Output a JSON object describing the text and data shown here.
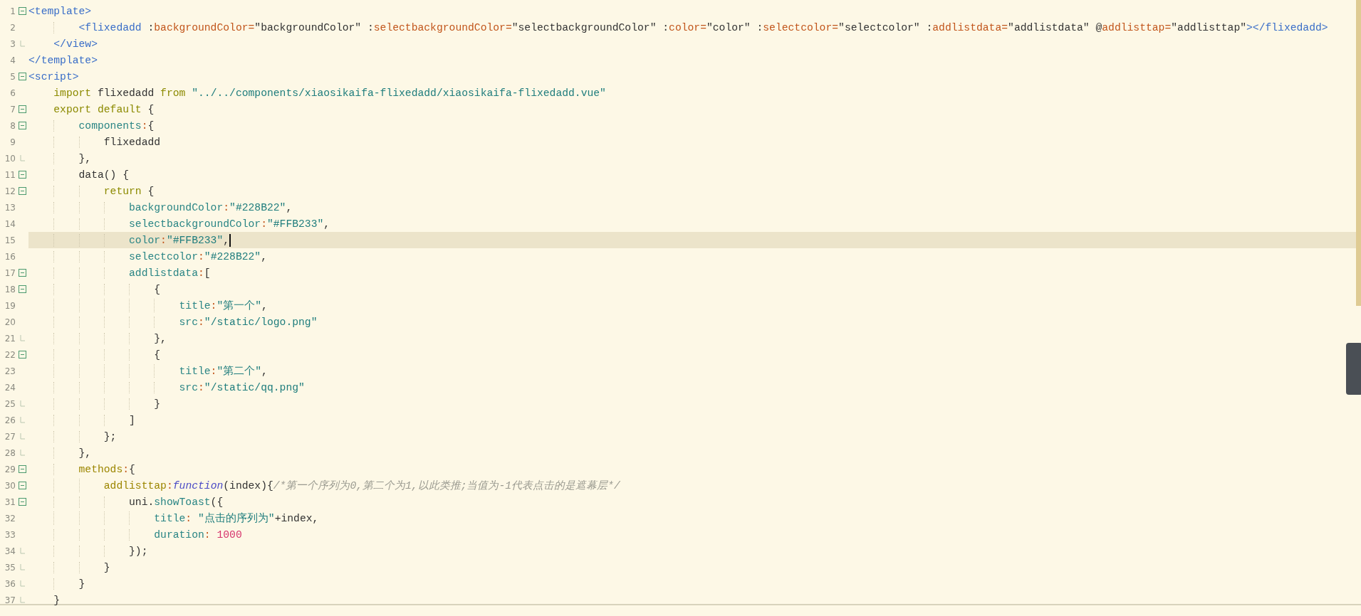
{
  "editor": {
    "lines": [
      {
        "n": "1",
        "kind": "fold-start",
        "selected": false,
        "code": [
          {
            "kind": "tag",
            "t": "<template>"
          }
        ]
      },
      {
        "n": "2",
        "kind": "plain",
        "selected": false,
        "code": [
          {
            "kind": "tag",
            "t": "        <flixedadd"
          },
          {
            "kind": "plain",
            "t": " :"
          },
          {
            "kind": "attr",
            "t": "backgroundColor="
          },
          {
            "kind": "plain",
            "t": "\"backgroundColor\" :"
          },
          {
            "kind": "attr",
            "t": "selectbackgroundColor="
          },
          {
            "kind": "plain",
            "t": "\"selectbackgroundColor\" :"
          },
          {
            "kind": "attr",
            "t": "color="
          },
          {
            "kind": "plain",
            "t": "\"color\" :"
          },
          {
            "kind": "attr",
            "t": "selectcolor="
          },
          {
            "kind": "plain",
            "t": "\"selectcolor\" :"
          },
          {
            "kind": "attr",
            "t": "addlistdata="
          },
          {
            "kind": "plain",
            "t": "\"addlistdata\" @"
          },
          {
            "kind": "attr",
            "t": "addlisttap="
          },
          {
            "kind": "plain",
            "t": "\"addlisttap\""
          },
          {
            "kind": "tag",
            "t": "></flixedadd>"
          }
        ]
      },
      {
        "n": "3",
        "kind": "fold-end",
        "selected": false,
        "code": [
          {
            "kind": "tag",
            "t": "    </view>"
          }
        ]
      },
      {
        "n": "4",
        "kind": "plain",
        "selected": false,
        "code": [
          {
            "kind": "tag",
            "t": "</template>"
          }
        ]
      },
      {
        "n": "5",
        "kind": "fold-start",
        "selected": false,
        "code": [
          {
            "kind": "tag",
            "t": "<script>"
          }
        ]
      },
      {
        "n": "6",
        "kind": "plain",
        "selected": false,
        "code": [
          {
            "kind": "keyword",
            "t": "    import"
          },
          {
            "kind": "plain",
            "t": " flixedadd "
          },
          {
            "kind": "keyword",
            "t": "from"
          },
          {
            "kind": "string",
            "t": " \"../../components/xiaosikaifa-flixedadd/xiaosikaifa-flixedadd.vue\""
          }
        ]
      },
      {
        "n": "7",
        "kind": "fold-start",
        "selected": false,
        "code": [
          {
            "kind": "keyword",
            "t": "    export default"
          },
          {
            "kind": "plain",
            "t": " {"
          }
        ]
      },
      {
        "n": "8",
        "kind": "fold-start",
        "selected": false,
        "code": [
          {
            "kind": "property",
            "t": "        components"
          },
          {
            "kind": "punct",
            "t": ":"
          },
          {
            "kind": "plain",
            "t": "{"
          }
        ]
      },
      {
        "n": "9",
        "kind": "plain",
        "selected": false,
        "code": [
          {
            "kind": "plain",
            "t": "            flixedadd"
          }
        ]
      },
      {
        "n": "10",
        "kind": "fold-end",
        "selected": false,
        "code": [
          {
            "kind": "plain",
            "t": "        },"
          }
        ]
      },
      {
        "n": "11",
        "kind": "fold-start",
        "selected": false,
        "code": [
          {
            "kind": "plain",
            "t": "        data() {"
          }
        ]
      },
      {
        "n": "12",
        "kind": "fold-start",
        "selected": false,
        "code": [
          {
            "kind": "keyword",
            "t": "            return"
          },
          {
            "kind": "plain",
            "t": " {"
          }
        ]
      },
      {
        "n": "13",
        "kind": "plain",
        "selected": false,
        "code": [
          {
            "kind": "property",
            "t": "                backgroundColor"
          },
          {
            "kind": "punct",
            "t": ":"
          },
          {
            "kind": "string",
            "t": "\"#228B22\""
          },
          {
            "kind": "plain",
            "t": ","
          }
        ]
      },
      {
        "n": "14",
        "kind": "plain",
        "selected": false,
        "code": [
          {
            "kind": "property",
            "t": "                selectbackgroundColor"
          },
          {
            "kind": "punct",
            "t": ":"
          },
          {
            "kind": "string",
            "t": "\"#FFB233\""
          },
          {
            "kind": "plain",
            "t": ","
          }
        ]
      },
      {
        "n": "15",
        "kind": "plain",
        "selected": true,
        "code": [
          {
            "kind": "property",
            "t": "                color"
          },
          {
            "kind": "punct",
            "t": ":"
          },
          {
            "kind": "string",
            "t": "\"#FFB233\""
          },
          {
            "kind": "plain",
            "t": ","
          }
        ]
      },
      {
        "n": "16",
        "kind": "plain",
        "selected": false,
        "code": [
          {
            "kind": "property",
            "t": "                selectcolor"
          },
          {
            "kind": "punct",
            "t": ":"
          },
          {
            "kind": "string",
            "t": "\"#228B22\""
          },
          {
            "kind": "plain",
            "t": ","
          }
        ]
      },
      {
        "n": "17",
        "kind": "fold-start",
        "selected": false,
        "code": [
          {
            "kind": "property",
            "t": "                addlistdata"
          },
          {
            "kind": "punct",
            "t": ":"
          },
          {
            "kind": "plain",
            "t": "["
          }
        ]
      },
      {
        "n": "18",
        "kind": "fold-start",
        "selected": false,
        "code": [
          {
            "kind": "plain",
            "t": "                    {"
          }
        ]
      },
      {
        "n": "19",
        "kind": "plain",
        "selected": false,
        "code": [
          {
            "kind": "property",
            "t": "                        title"
          },
          {
            "kind": "punct",
            "t": ":"
          },
          {
            "kind": "string",
            "t": "\"第一个\""
          },
          {
            "kind": "plain",
            "t": ","
          }
        ]
      },
      {
        "n": "20",
        "kind": "plain",
        "selected": false,
        "code": [
          {
            "kind": "property",
            "t": "                        src"
          },
          {
            "kind": "punct",
            "t": ":"
          },
          {
            "kind": "string",
            "t": "\"/static/logo.png\""
          }
        ]
      },
      {
        "n": "21",
        "kind": "fold-end",
        "selected": false,
        "code": [
          {
            "kind": "plain",
            "t": "                    },"
          }
        ]
      },
      {
        "n": "22",
        "kind": "fold-start",
        "selected": false,
        "code": [
          {
            "kind": "plain",
            "t": "                    {"
          }
        ]
      },
      {
        "n": "23",
        "kind": "plain",
        "selected": false,
        "code": [
          {
            "kind": "property",
            "t": "                        title"
          },
          {
            "kind": "punct",
            "t": ":"
          },
          {
            "kind": "string",
            "t": "\"第二个\""
          },
          {
            "kind": "plain",
            "t": ","
          }
        ]
      },
      {
        "n": "24",
        "kind": "plain",
        "selected": false,
        "code": [
          {
            "kind": "property",
            "t": "                        src"
          },
          {
            "kind": "punct",
            "t": ":"
          },
          {
            "kind": "string",
            "t": "\"/static/qq.png\""
          }
        ]
      },
      {
        "n": "25",
        "kind": "fold-end",
        "selected": false,
        "code": [
          {
            "kind": "plain",
            "t": "                    }"
          }
        ]
      },
      {
        "n": "26",
        "kind": "fold-end",
        "selected": false,
        "code": [
          {
            "kind": "plain",
            "t": "                ]"
          }
        ]
      },
      {
        "n": "27",
        "kind": "fold-end",
        "selected": false,
        "code": [
          {
            "kind": "plain",
            "t": "            };"
          }
        ]
      },
      {
        "n": "28",
        "kind": "fold-end",
        "selected": false,
        "code": [
          {
            "kind": "plain",
            "t": "        },"
          }
        ]
      },
      {
        "n": "29",
        "kind": "fold-start",
        "selected": false,
        "code": [
          {
            "kind": "method",
            "t": "        methods"
          },
          {
            "kind": "punct",
            "t": ":"
          },
          {
            "kind": "plain",
            "t": "{"
          }
        ]
      },
      {
        "n": "30",
        "kind": "fold-start",
        "selected": false,
        "code": [
          {
            "kind": "method",
            "t": "            addlisttap"
          },
          {
            "kind": "punct",
            "t": ":"
          },
          {
            "kind": "function",
            "t": "function"
          },
          {
            "kind": "plain",
            "t": "(index){"
          },
          {
            "kind": "comment",
            "t": "/*第一个序列为0,第二个为1,以此类推;当值为-1代表点击的是遮幕层*/"
          }
        ]
      },
      {
        "n": "31",
        "kind": "fold-start",
        "selected": false,
        "code": [
          {
            "kind": "plain",
            "t": "                uni."
          },
          {
            "kind": "property",
            "t": "showToast"
          },
          {
            "kind": "plain",
            "t": "({"
          }
        ]
      },
      {
        "n": "32",
        "kind": "plain",
        "selected": false,
        "code": [
          {
            "kind": "property",
            "t": "                    title"
          },
          {
            "kind": "punct",
            "t": ":"
          },
          {
            "kind": "string",
            "t": " \"点击的序列为\""
          },
          {
            "kind": "plain",
            "t": "+index,"
          }
        ]
      },
      {
        "n": "33",
        "kind": "plain",
        "selected": false,
        "code": [
          {
            "kind": "property",
            "t": "                    duration"
          },
          {
            "kind": "punct",
            "t": ":"
          },
          {
            "kind": "number",
            "t": " 1000"
          }
        ]
      },
      {
        "n": "34",
        "kind": "fold-end",
        "selected": false,
        "code": [
          {
            "kind": "plain",
            "t": "                });"
          }
        ]
      },
      {
        "n": "35",
        "kind": "fold-end",
        "selected": false,
        "code": [
          {
            "kind": "plain",
            "t": "            }"
          }
        ]
      },
      {
        "n": "36",
        "kind": "fold-end",
        "selected": false,
        "code": [
          {
            "kind": "plain",
            "t": "        }"
          }
        ]
      },
      {
        "n": "37",
        "kind": "fold-end",
        "selected": false,
        "code": [
          {
            "kind": "plain",
            "t": "    }"
          }
        ]
      }
    ]
  }
}
